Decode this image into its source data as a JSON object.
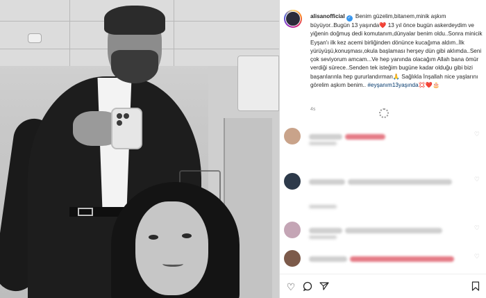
{
  "post": {
    "username": "alisanofficial",
    "verified_icon": "verified-badge-icon",
    "caption_line1": "Benim güzelim,bitanem,minik aşkım büyüyor..Bugün 13 yaşında",
    "heart": "❤️",
    "caption_line2": " 13 yıl önce bugün askerdeydim ve yiğenin doğmuş dedi komutanım,dünyalar benim oldu..Sonra minicik Eyşan'ı ilk kez acemi birliğinden dönünce kucağıma aldım..İlk yürüyüşü,konuşması,okula başlaması herşey dün gibi aklımda..Seni çok seviyorum amcam...Ve hep yanında olacağım Allah bana ömür verdiği sürece..Senden tek isteğim bugüne kadar olduğu gibi bizi başarılarınla hep gururlandırman",
    "pray_emoji": "🙏",
    "caption_line3": " Sağlıkla İnşallah nice yaşlarını görelim aşkım benim..",
    "hashtag": "#eyşanım13yaşında",
    "end_emojis": "💢❤️🎂",
    "time_ago": "4s"
  },
  "comments": [
    {
      "avatar_color": "#c9a38a",
      "name_width": 48,
      "text_red": 58,
      "reply_width": 40
    },
    {
      "avatar_color": "#2d3a4a",
      "name_width": 52,
      "text_gray": 150,
      "reply_width": 40
    },
    {
      "avatar_color": "#c4a5b5",
      "name_width": 48,
      "text_gray": 140,
      "reply_width": 40
    },
    {
      "avatar_color": "#7c5a4a",
      "name_width": 55,
      "text_red": 150,
      "reply_width": 40
    }
  ],
  "icons": {
    "loading": "loading-spinner-icon",
    "like": "heart-icon",
    "comment": "comment-icon",
    "share": "share-icon",
    "save": "bookmark-icon"
  },
  "colors": {
    "link": "#00376b",
    "verified": "#3897f0",
    "muted": "#8e8e8e"
  }
}
